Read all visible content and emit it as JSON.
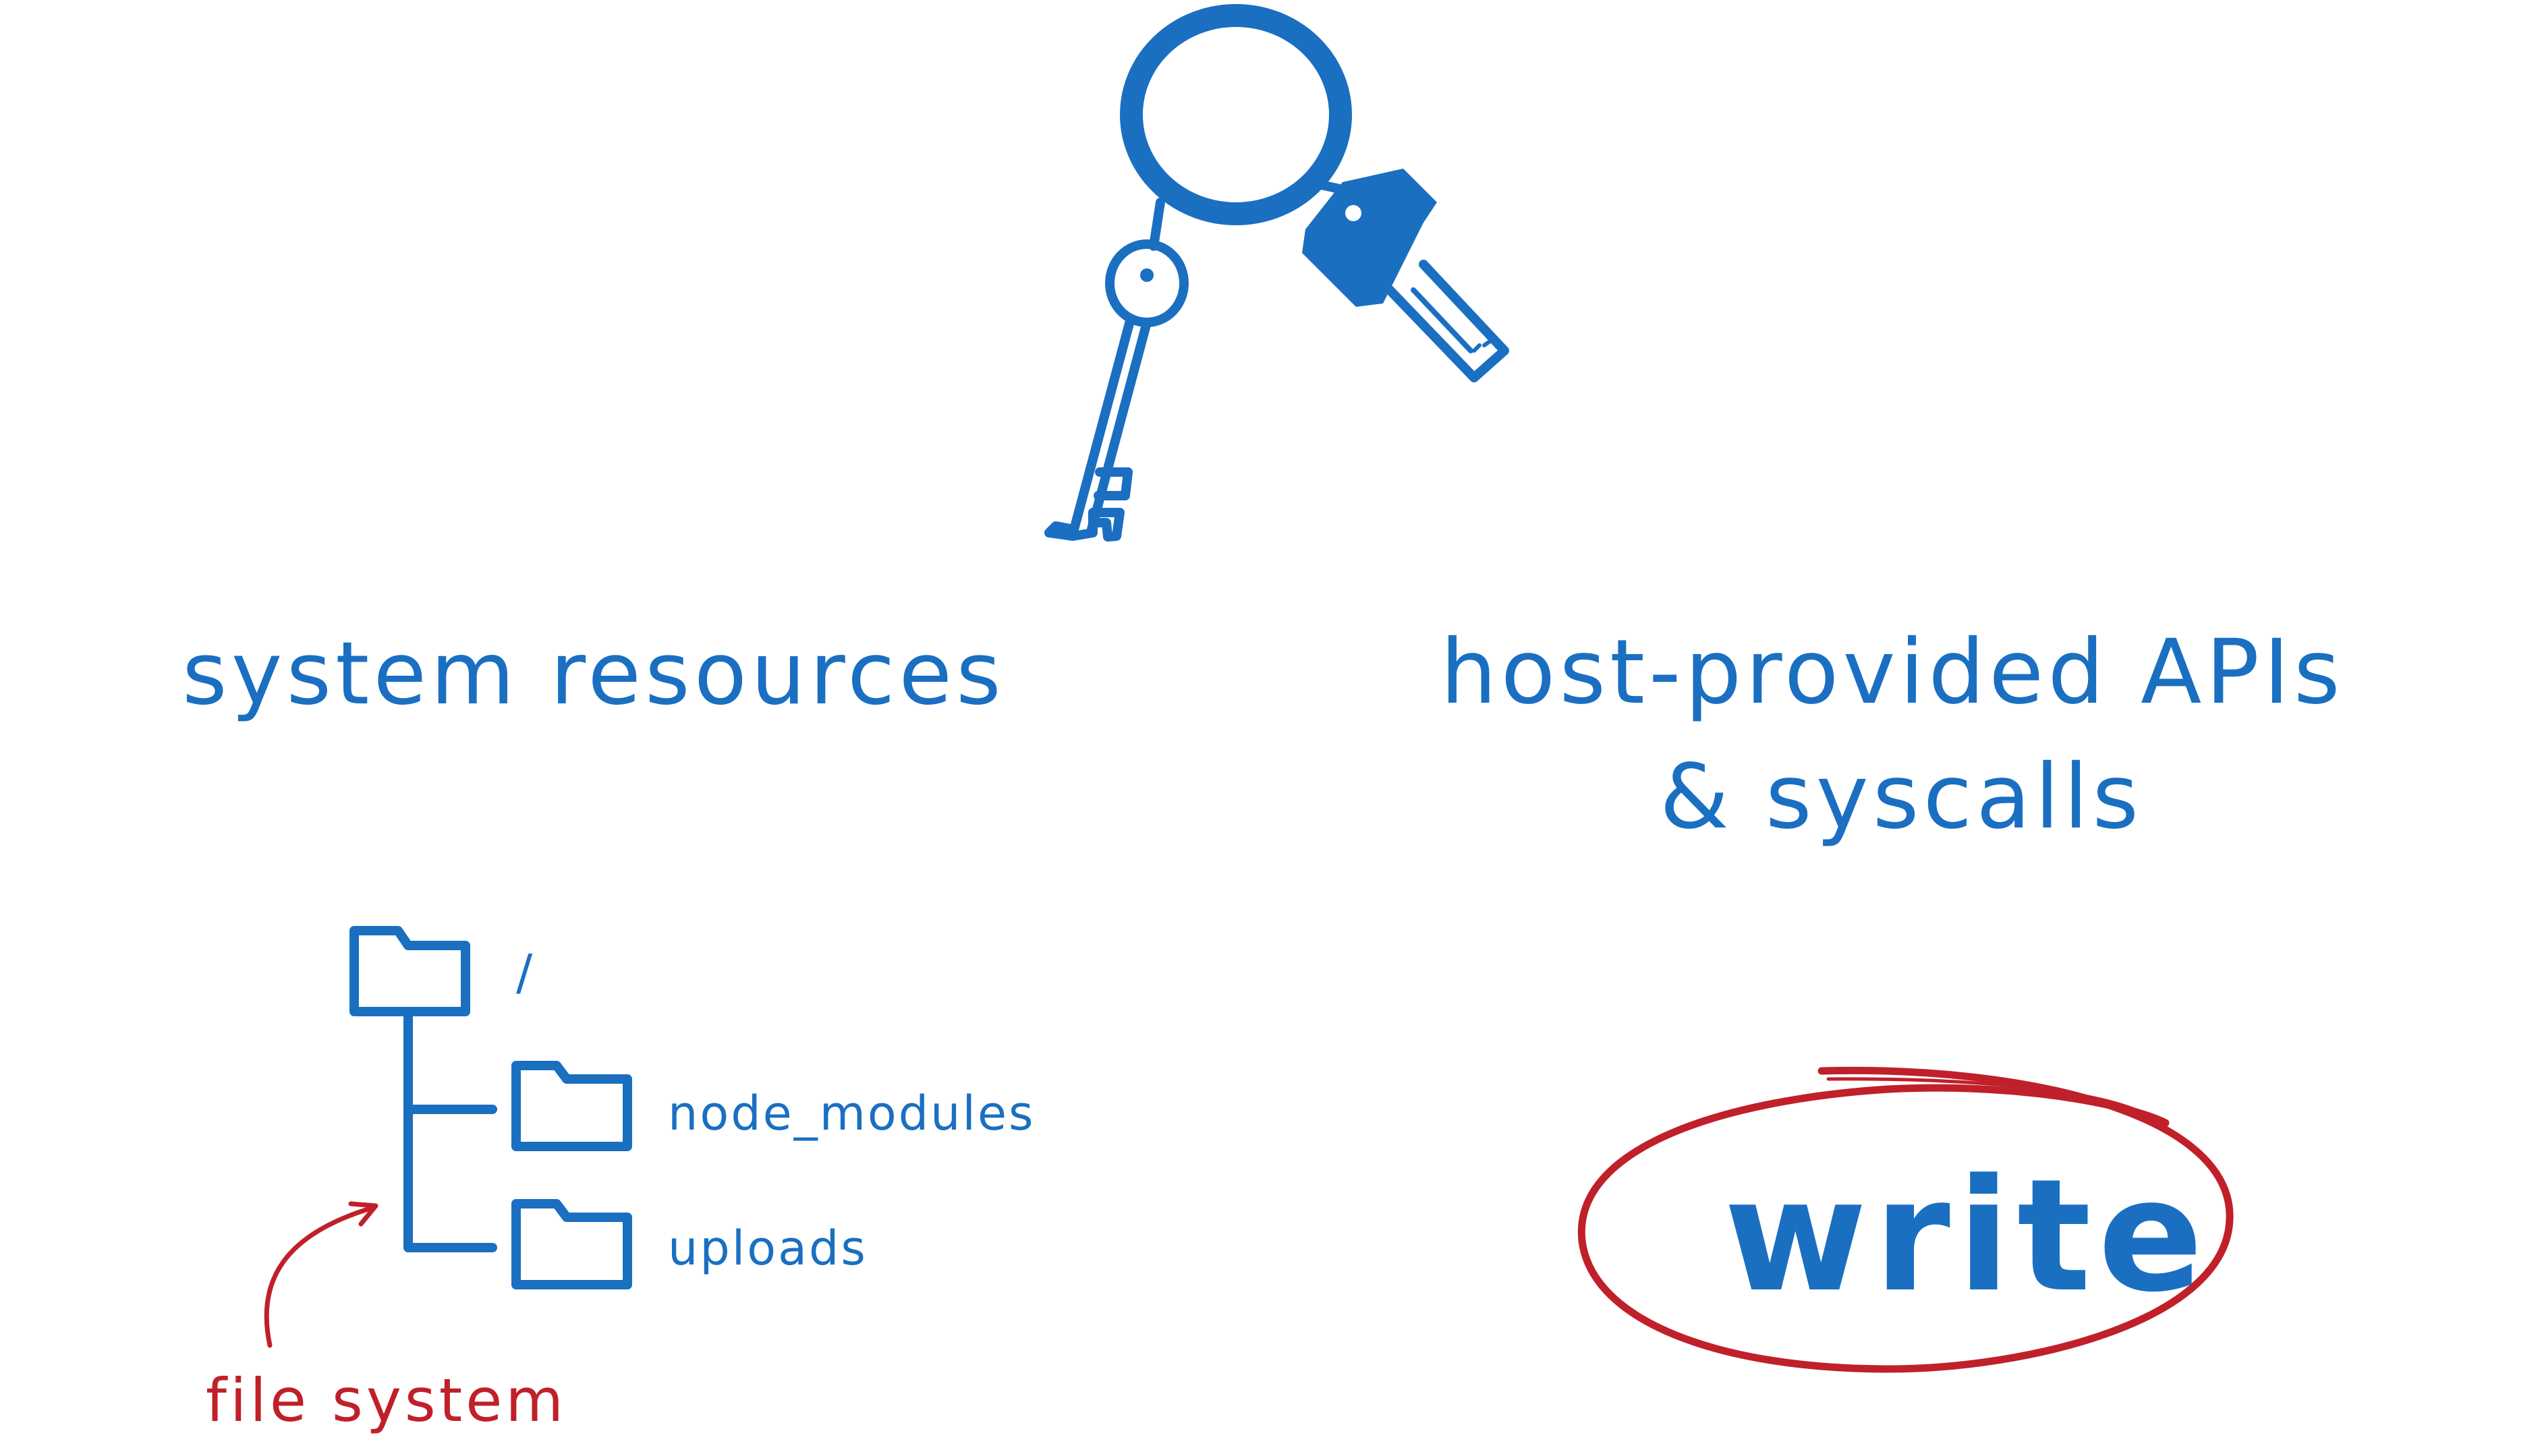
{
  "colors": {
    "blue": "#1a6fc1",
    "red": "#c0202a",
    "background": "#ffffff"
  },
  "icons": {
    "keys": "keyring-icon",
    "folder": "folder-icon",
    "arrow": "curved-arrow-icon"
  },
  "left": {
    "heading": "system resources",
    "tree": {
      "root": "/",
      "children": [
        "node_modules",
        "uploads"
      ]
    },
    "annotation": "file system"
  },
  "right": {
    "heading_line1": "host-provided APIs",
    "heading_line2": "& syscalls",
    "highlight": "write"
  }
}
